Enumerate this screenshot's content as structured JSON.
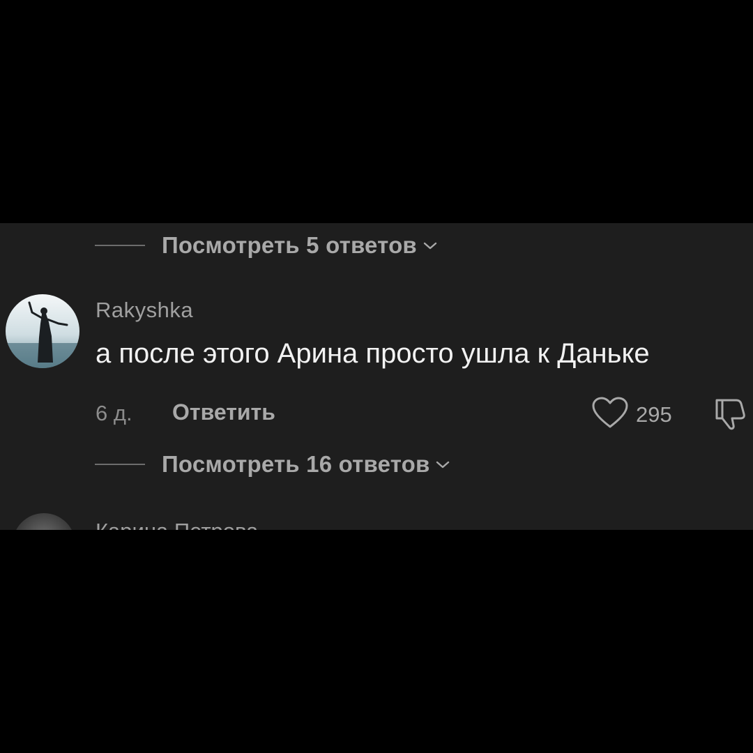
{
  "thread": {
    "prev_view_replies": "Посмотреть 5 ответов",
    "comment": {
      "avatar": "avatar-photo",
      "username": "Rakyshka",
      "text": "а после этого Арина просто ушла к Даньке",
      "time": "6 д.",
      "reply_label": "Ответить",
      "like_icon": "heart-icon",
      "like_count": "295",
      "dislike_icon": "thumbs-down-icon"
    },
    "view_replies": "Посмотреть 16 ответов",
    "next_comment": {
      "username": "Карина Петрова"
    }
  },
  "colors": {
    "background": "#000000",
    "panel": "#1e1e1e",
    "primary_text": "#f2f2f2",
    "secondary_text": "#a9a9a9"
  }
}
